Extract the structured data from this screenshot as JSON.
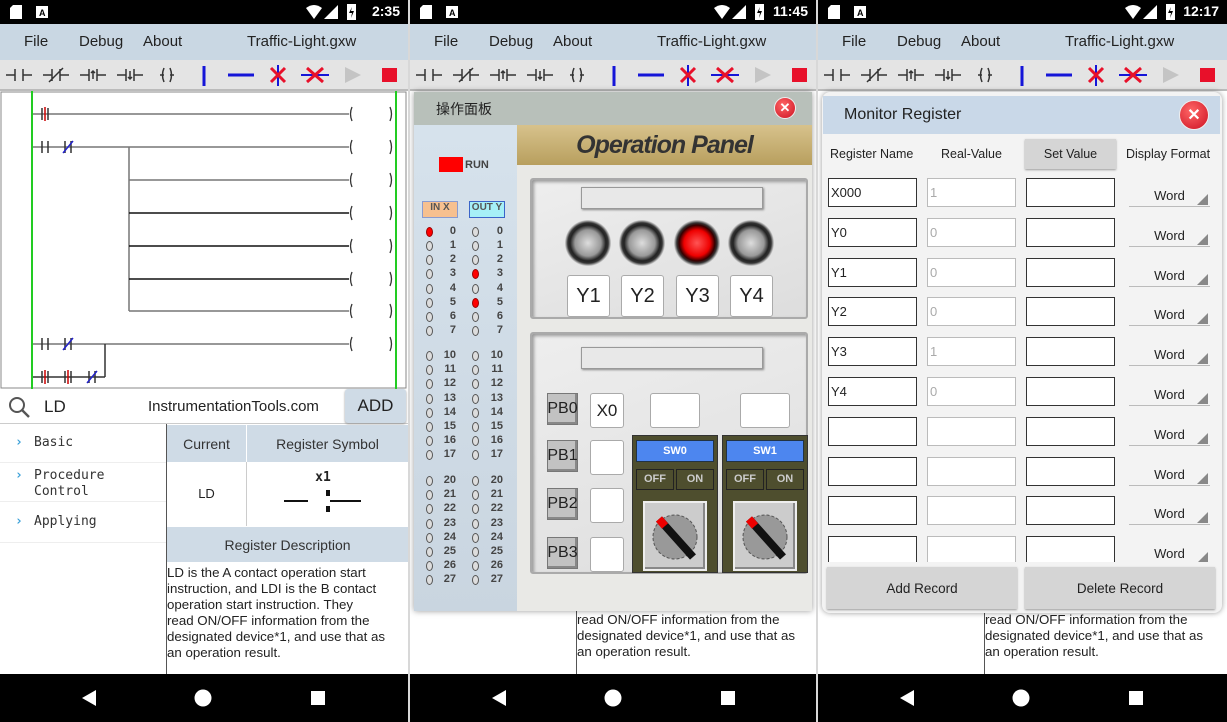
{
  "phones": [
    {
      "time": "2:35"
    },
    {
      "time": "11:45"
    },
    {
      "time": "12:17"
    }
  ],
  "menu": {
    "file": "File",
    "debug": "Debug",
    "about": "About",
    "filename": "Traffic-Light.gxw"
  },
  "toolbar": {
    "icons": [
      "no-contact-icon",
      "nc-contact-icon",
      "rising-contact-icon",
      "falling-contact-icon",
      "coil-icon",
      "vertical-line-icon",
      "horizontal-line-icon",
      "delete-vertical-icon",
      "delete-horizontal-icon",
      "run-icon",
      "stop-icon"
    ],
    "accent_blue": "#1515d8",
    "accent_red": "#e8102a"
  },
  "editor": {
    "search_value": "LD",
    "watermark": "InstrumentationTools.com",
    "add_label": "ADD",
    "categories": [
      "Basic",
      "Procedure\nControl",
      "Applying"
    ],
    "col_current": "Current",
    "col_symbol": "Register Symbol",
    "current": "LD",
    "symbol_label": "x1",
    "desc_header": "Register Description",
    "desc_lines": [
      "LD is the A contact operation start",
      "instruction, and LDI is the B contact",
      "operation start instruction. They",
      "read ON/OFF information from the",
      "designated device*1, and use that as",
      "an operation result."
    ]
  },
  "operation_panel": {
    "title": "操作面板",
    "header": "Operation Panel",
    "run_label": "RUN",
    "in_label": "IN X",
    "out_label": "OUT Y",
    "io_numbers": [
      "0",
      "1",
      "2",
      "3",
      "4",
      "5",
      "6",
      "7",
      "10",
      "11",
      "12",
      "13",
      "14",
      "15",
      "16",
      "17",
      "20",
      "21",
      "22",
      "23",
      "24",
      "25",
      "26",
      "27"
    ],
    "in_on": [
      "0"
    ],
    "out_on": [
      "3",
      "5"
    ],
    "lamps": [
      {
        "label": "Y1",
        "on": false
      },
      {
        "label": "Y2",
        "on": false
      },
      {
        "label": "Y3",
        "on": true
      },
      {
        "label": "Y4",
        "on": false
      }
    ],
    "push_buttons": [
      {
        "label": "PB0",
        "addr": "X0"
      },
      {
        "label": "PB1",
        "addr": ""
      },
      {
        "label": "PB2",
        "addr": ""
      },
      {
        "label": "PB3",
        "addr": ""
      }
    ],
    "switches": [
      {
        "label": "SW0",
        "off": "OFF",
        "on": "ON"
      },
      {
        "label": "SW1",
        "off": "OFF",
        "on": "ON"
      }
    ]
  },
  "monitor": {
    "title": "Monitor Register",
    "headers": {
      "name": "Register Name",
      "real": "Real-Value",
      "set": "Set Value",
      "format": "Display Format"
    },
    "rows": [
      {
        "name": "X000",
        "real": "1",
        "set": "",
        "format": "Word"
      },
      {
        "name": "Y0",
        "real": "0",
        "set": "",
        "format": "Word"
      },
      {
        "name": "Y1",
        "real": "0",
        "set": "",
        "format": "Word"
      },
      {
        "name": "Y2",
        "real": "0",
        "set": "",
        "format": "Word"
      },
      {
        "name": "Y3",
        "real": "1",
        "set": "",
        "format": "Word"
      },
      {
        "name": "Y4",
        "real": "0",
        "set": "",
        "format": "Word"
      },
      {
        "name": "",
        "real": "",
        "set": "",
        "format": "Word"
      },
      {
        "name": "",
        "real": "",
        "set": "",
        "format": "Word"
      },
      {
        "name": "",
        "real": "",
        "set": "",
        "format": "Word"
      },
      {
        "name": "",
        "real": "",
        "set": "",
        "format": "Word"
      }
    ],
    "add_label": "Add Record",
    "delete_label": "Delete Record"
  }
}
